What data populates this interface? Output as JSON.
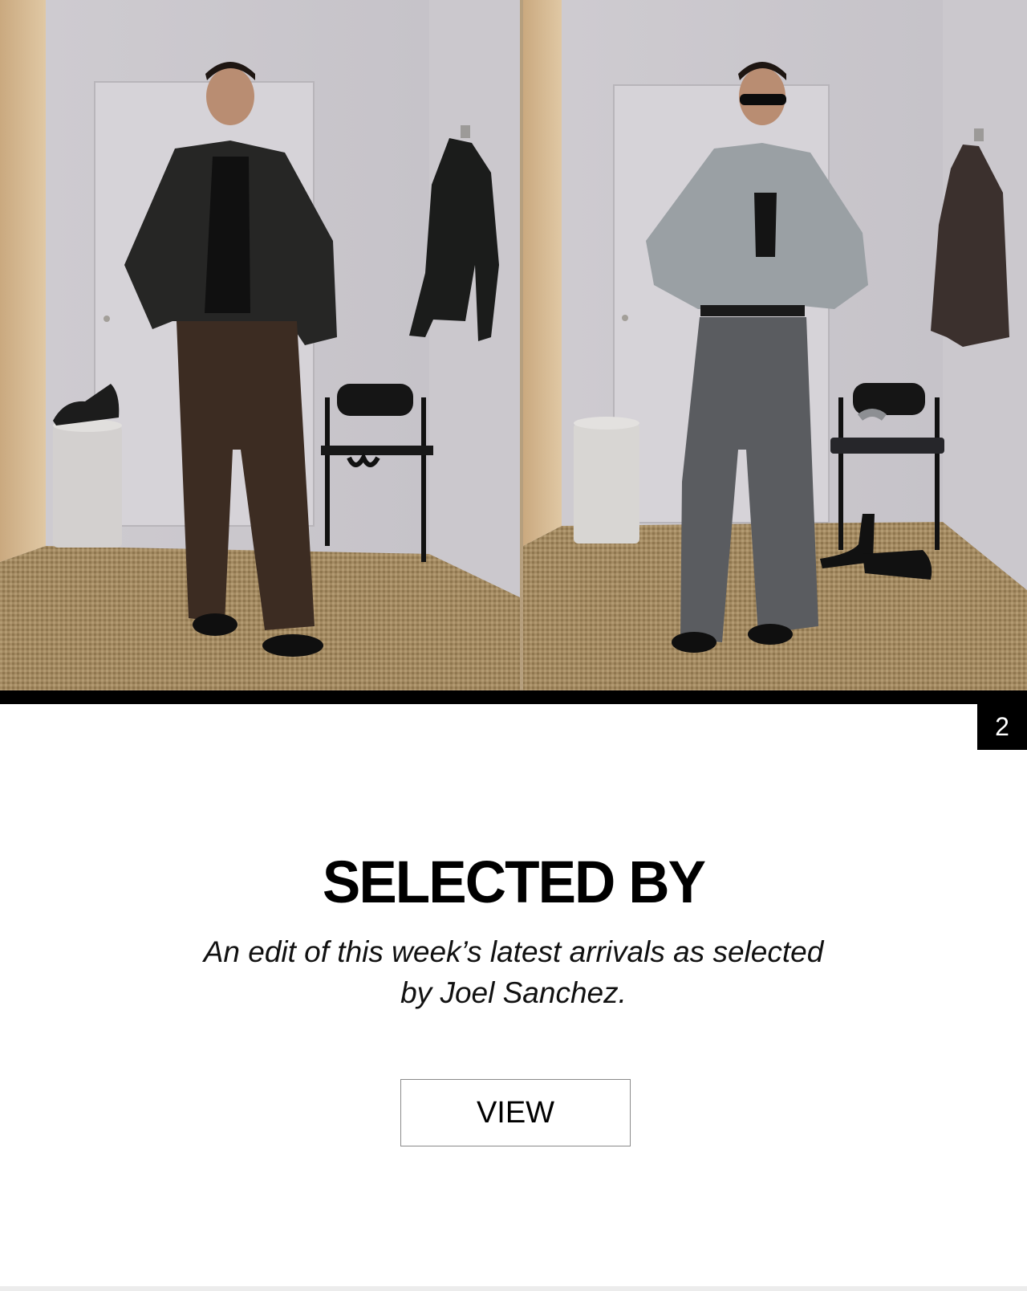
{
  "hero": {
    "panels": [
      {
        "name": "look-1",
        "outfit": "black-leather-jacket-brown-trousers"
      },
      {
        "name": "look-2",
        "outfit": "grey-striped-shirt-grey-wide-trousers"
      }
    ]
  },
  "slide_counter": "2",
  "promo": {
    "title": "SELECTED BY",
    "subtitle_line1": "An edit of this week’s latest arrivals as selected",
    "subtitle_line2": "by Joel Sanchez.",
    "button_label": "VIEW"
  },
  "colors": {
    "accent": "#000000",
    "background": "#ffffff",
    "button_border": "#8a8a8a"
  }
}
